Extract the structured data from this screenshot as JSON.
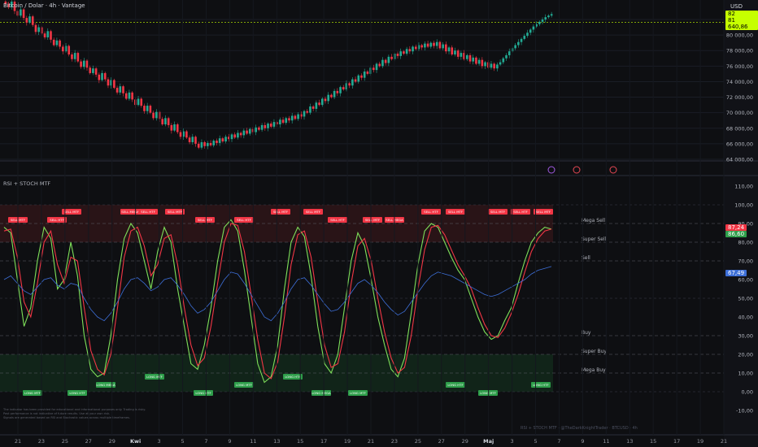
{
  "header": {
    "title": "Bitcoin / Dolar · 4h · Vantage",
    "currency": "USD"
  },
  "indicator": {
    "name": "RSI + STOCH MTF"
  },
  "price_axis": {
    "ticks": [
      "82 000,00",
      "80 000,00",
      "78 000,00",
      "76 000,00",
      "74 000,00",
      "72 000,00",
      "70 000,00",
      "68 000,00",
      "66 000,00",
      "64 000,00"
    ],
    "last_price": "81 640,86",
    "last_price_top": "82 080,00"
  },
  "osc_axis": {
    "ticks": [
      "110,00",
      "100,00",
      "90,00",
      "80,00",
      "70,00",
      "60,00",
      "50,00",
      "40,00",
      "30,00",
      "20,00",
      "10,00",
      "0,00",
      "-10,00"
    ],
    "tag_red": "87,24",
    "tag_green": "86,60",
    "tag_blue": "67,49"
  },
  "levels": [
    {
      "label": "Mega Sell",
      "value": 90
    },
    {
      "label": "Super Sell",
      "value": 80
    },
    {
      "label": "Sell",
      "value": 70
    },
    {
      "label": "Buy",
      "value": 30
    },
    {
      "label": "Super Buy",
      "value": 20
    },
    {
      "label": "Mega Buy",
      "value": 10
    }
  ],
  "x_axis": {
    "labels": [
      "21",
      "23",
      "25",
      "27",
      "29",
      "Kwi",
      "3",
      "5",
      "7",
      "9",
      "11",
      "13",
      "15",
      "17",
      "19",
      "21",
      "23",
      "25",
      "27",
      "29",
      "Maj",
      "3",
      "5",
      "7",
      "9",
      "11",
      "13",
      "15",
      "17",
      "19",
      "21"
    ]
  },
  "sell_labels": [
    "SELL MTF",
    "SELL HTF",
    "SELL MTF",
    "SELL MEGA",
    "SELL HTF",
    "SELL MTF",
    "SELL MTF",
    "SELL HTF",
    "SELL MTF"
  ],
  "buy_labels": [
    "LONG MTF",
    "LONG HTF",
    "LONG MEGA",
    "LONG MTF",
    "LONG HTF"
  ],
  "notes": [
    "The indicator has been provided for educational and informational purposes only. Trading is risky.",
    "Past performance is not indicative of future results. Use at your own risk.",
    "Signals are generated based on RSI and Stochastic values across multiple timeframes."
  ],
  "watermark": "RSI + STOCH MTF · @TheDarkKnightTrader · BTCUSD · 4h",
  "colors": {
    "bull": "#22ab94",
    "bear": "#f23645",
    "osc_green": "#7ee05a",
    "osc_red": "#f23645",
    "rsi_blue": "#3d6fd8",
    "accent_lime": "#c6ff00"
  },
  "chart_data": [
    {
      "type": "candlestick",
      "title": "Bitcoin / Dolar · 4h · Vantage",
      "ylim": [
        63500,
        82800
      ],
      "close": [
        84000,
        83600,
        84300,
        83100,
        82500,
        83300,
        82200,
        81600,
        82400,
        81300,
        80400,
        81000,
        80200,
        79700,
        80500,
        79400,
        78700,
        79300,
        78500,
        77900,
        78600,
        77500,
        76900,
        77700,
        76600,
        75900,
        76700,
        75800,
        75100,
        75700,
        74900,
        74200,
        75100,
        74300,
        73500,
        74200,
        73200,
        72600,
        73400,
        72500,
        71800,
        72600,
        71700,
        71000,
        71800,
        70900,
        70200,
        70900,
        70000,
        69300,
        70100,
        69200,
        68500,
        69300,
        68400,
        67700,
        68500,
        67500,
        66900,
        67600,
        66800,
        66200,
        66900,
        66000,
        65500,
        66200,
        65700,
        66100,
        65800,
        66400,
        66100,
        66700,
        66300,
        66900,
        66600,
        67200,
        66800,
        67400,
        67100,
        67700,
        67300,
        67900,
        67500,
        68100,
        67800,
        68400,
        68000,
        68600,
        68200,
        68800,
        68500,
        69100,
        68700,
        69300,
        69000,
        69600,
        69200,
        69800,
        69500,
        70200,
        70000,
        70800,
        70500,
        71300,
        71000,
        71800,
        71500,
        72300,
        72000,
        72800,
        72500,
        73300,
        73000,
        73800,
        73500,
        74300,
        74000,
        74800,
        74500,
        75300,
        75000,
        75800,
        75500,
        76300,
        76000,
        76800,
        76400,
        77200,
        76900,
        77600,
        77300,
        77900,
        77600,
        78200,
        77900,
        78500,
        78200,
        78700,
        78400,
        78900,
        78500,
        79000,
        78600,
        79100,
        78300,
        78800,
        77900,
        78400,
        77500,
        78000,
        77200,
        77700,
        76900,
        77400,
        76600,
        77100,
        76300,
        76800,
        76000,
        76500,
        75800,
        76300,
        75700,
        76200,
        76500,
        77000,
        77400,
        77900,
        78300,
        78700,
        79100,
        79500,
        79900,
        80300,
        80700,
        81100,
        81400,
        81700,
        82000,
        82300,
        82500,
        82700
      ]
    },
    {
      "type": "line",
      "title": "RSI + STOCH MTF",
      "ylim": [
        -10,
        110
      ],
      "series": [
        {
          "color": "#7ee05a",
          "values": [
            88,
            85,
            60,
            35,
            45,
            70,
            88,
            82,
            55,
            60,
            80,
            62,
            30,
            12,
            8,
            10,
            30,
            60,
            82,
            90,
            85,
            70,
            55,
            75,
            88,
            80,
            55,
            35,
            15,
            12,
            25,
            45,
            70,
            88,
            92,
            86,
            65,
            40,
            15,
            5,
            8,
            25,
            55,
            80,
            88,
            83,
            62,
            35,
            15,
            10,
            20,
            45,
            70,
            85,
            78,
            60,
            40,
            25,
            12,
            8,
            18,
            42,
            68,
            86,
            90,
            88,
            80,
            72,
            65,
            60,
            50,
            40,
            32,
            28,
            30,
            38,
            45,
            58,
            70,
            80,
            85,
            88,
            87
          ]
        },
        {
          "color": "#f23645",
          "values": [
            86,
            87,
            72,
            48,
            40,
            58,
            80,
            86,
            68,
            58,
            72,
            70,
            45,
            22,
            12,
            9,
            20,
            45,
            72,
            86,
            88,
            78,
            62,
            68,
            82,
            84,
            68,
            45,
            25,
            14,
            18,
            35,
            58,
            80,
            90,
            89,
            75,
            52,
            28,
            10,
            7,
            16,
            40,
            68,
            84,
            86,
            72,
            48,
            25,
            13,
            15,
            32,
            58,
            78,
            82,
            70,
            50,
            32,
            18,
            10,
            13,
            30,
            55,
            76,
            88,
            89,
            84,
            76,
            68,
            62,
            55,
            45,
            36,
            30,
            29,
            34,
            42,
            52,
            64,
            75,
            82,
            86,
            87
          ]
        },
        {
          "color": "#3d6fd8",
          "values": [
            60,
            62,
            58,
            54,
            52,
            56,
            60,
            61,
            57,
            55,
            58,
            57,
            50,
            44,
            40,
            38,
            42,
            48,
            55,
            60,
            61,
            58,
            54,
            56,
            60,
            61,
            57,
            52,
            46,
            42,
            44,
            48,
            54,
            60,
            64,
            63,
            58,
            52,
            46,
            40,
            38,
            42,
            48,
            55,
            60,
            61,
            57,
            52,
            47,
            43,
            44,
            48,
            53,
            58,
            60,
            57,
            53,
            48,
            44,
            41,
            43,
            48,
            53,
            58,
            62,
            64,
            63,
            62,
            60,
            58,
            56,
            54,
            52,
            51,
            52,
            54,
            56,
            58,
            60,
            63,
            65,
            66,
            67
          ]
        }
      ]
    }
  ]
}
